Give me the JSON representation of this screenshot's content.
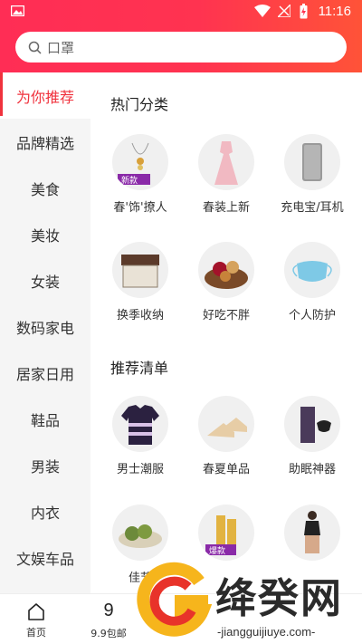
{
  "status": {
    "time": "11:16"
  },
  "search": {
    "placeholder": "口罩"
  },
  "sidebar": {
    "items": [
      {
        "label": "为你推荐"
      },
      {
        "label": "品牌精选"
      },
      {
        "label": "美食"
      },
      {
        "label": "美妆"
      },
      {
        "label": "女装"
      },
      {
        "label": "数码家电"
      },
      {
        "label": "居家日用"
      },
      {
        "label": "鞋品"
      },
      {
        "label": "男装"
      },
      {
        "label": "内衣"
      },
      {
        "label": "文娱车品"
      }
    ]
  },
  "hot": {
    "title": "热门分类",
    "items": [
      {
        "label": "春'饰'撩人",
        "badge": "新款"
      },
      {
        "label": "春装上新"
      },
      {
        "label": "充电宝/耳机"
      },
      {
        "label": "换季收纳"
      },
      {
        "label": "好吃不胖"
      },
      {
        "label": "个人防护"
      }
    ]
  },
  "recommend": {
    "title": "推荐清单",
    "items": [
      {
        "label": "男士潮服"
      },
      {
        "label": "春夏单品"
      },
      {
        "label": "助眠神器"
      },
      {
        "label": "佳节",
        "badge": ""
      },
      {
        "label": "",
        "badge": "爆款"
      },
      {
        "label": ""
      }
    ]
  },
  "nav": {
    "items": [
      {
        "label": "首页"
      },
      {
        "label": "9.9包邮",
        "glyph": "9"
      }
    ]
  },
  "watermark": {
    "text": "绛癸网",
    "url": "-jiangguijiuye.com-"
  },
  "colors": {
    "accent": "#f0323d",
    "header_start": "#ff2d55",
    "header_end": "#ff5338"
  }
}
